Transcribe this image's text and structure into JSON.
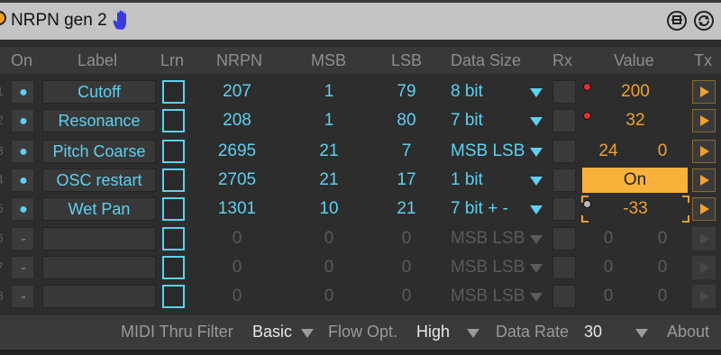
{
  "title": "NRPN gen 2",
  "headers": {
    "on": "On",
    "label": "Label",
    "lrn": "Lrn",
    "nrpn": "NRPN",
    "msb": "MSB",
    "lsb": "LSB",
    "data_size": "Data Size",
    "rx": "Rx",
    "value": "Value",
    "tx": "Tx"
  },
  "rows": [
    {
      "num": "1",
      "on": "●",
      "label": "Cutoff",
      "nrpn": "207",
      "msb": "1",
      "lsb": "79",
      "data_size": "8 bit",
      "value": "200",
      "value2": "",
      "led": "red"
    },
    {
      "num": "2",
      "on": "●",
      "label": "Resonance",
      "nrpn": "208",
      "msb": "1",
      "lsb": "80",
      "data_size": "7 bit",
      "value": "32",
      "value2": "",
      "led": "red"
    },
    {
      "num": "3",
      "on": "●",
      "label": "Pitch Coarse",
      "nrpn": "2695",
      "msb": "21",
      "lsb": "7",
      "data_size": "MSB LSB",
      "value": "24",
      "value2": "0",
      "led": ""
    },
    {
      "num": "4",
      "on": "●",
      "label": "OSC restart",
      "nrpn": "2705",
      "msb": "21",
      "lsb": "17",
      "data_size": "1 bit",
      "value": "On",
      "value2": "",
      "led": ""
    },
    {
      "num": "5",
      "on": "●",
      "label": "Wet Pan",
      "nrpn": "1301",
      "msb": "10",
      "lsb": "21",
      "data_size": "7 bit + -",
      "value": "-33",
      "value2": "",
      "led": "gray"
    },
    {
      "num": "6",
      "on": "-",
      "label": "",
      "nrpn": "0",
      "msb": "0",
      "lsb": "0",
      "data_size": "MSB LSB",
      "value": "0",
      "value2": "0",
      "led": ""
    },
    {
      "num": "7",
      "on": "-",
      "label": "",
      "nrpn": "0",
      "msb": "0",
      "lsb": "0",
      "data_size": "MSB LSB",
      "value": "0",
      "value2": "0",
      "led": ""
    },
    {
      "num": "8",
      "on": "-",
      "label": "",
      "nrpn": "0",
      "msb": "0",
      "lsb": "0",
      "data_size": "MSB LSB",
      "value": "0",
      "value2": "0",
      "led": ""
    }
  ],
  "footer": {
    "midi_thru_label": "MIDI Thru Filter",
    "midi_thru_value": "Basic",
    "flow_label": "Flow Opt.",
    "flow_value": "High",
    "rate_label": "Data Rate",
    "rate_value": "30",
    "about": "About"
  },
  "colors": {
    "accent_blue": "#5fd0f0",
    "accent_orange": "#f0a030",
    "led_red": "#e03030"
  },
  "icons": {
    "title_hand": "hand-icon",
    "pin": "pin-icon",
    "refresh": "refresh-icon"
  }
}
